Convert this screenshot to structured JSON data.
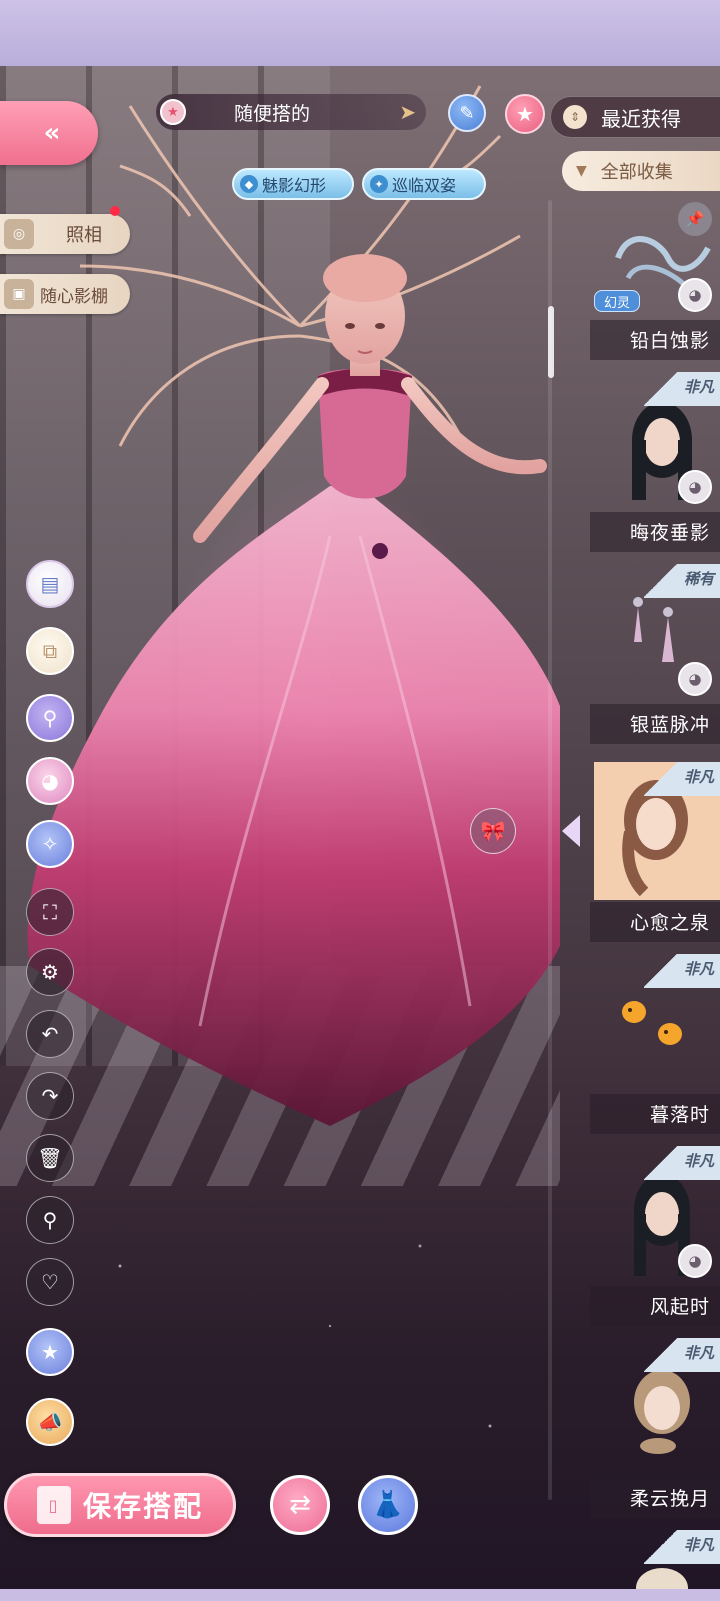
{
  "outfit": {
    "name": "随便搭的"
  },
  "skills": [
    {
      "label": "魅影幻形"
    },
    {
      "label": "巡临双姿"
    }
  ],
  "side_buttons": {
    "photo": "照相",
    "studio": "随心影棚"
  },
  "wardrobe": {
    "sort_label": "最近获得",
    "filter_label": "全部收集",
    "items": [
      {
        "name": "铅白蚀影",
        "tag": "幻灵"
      },
      {
        "name": "晦夜垂影",
        "rarity": "非凡"
      },
      {
        "name": "银蓝脉冲",
        "rarity": "稀有"
      },
      {
        "name": "心愈之泉",
        "rarity": "非凡"
      },
      {
        "name": "暮落时",
        "rarity": "非凡"
      },
      {
        "name": "风起时",
        "rarity": "非凡"
      },
      {
        "name": "柔云挽月",
        "rarity": "非凡"
      },
      {
        "rarity": "非凡"
      }
    ]
  },
  "bottom": {
    "save_label": "保存搭配"
  },
  "colors": {
    "accent_pink": "#ef6c8c",
    "panel_cream": "#f1e5d6",
    "skill_blue": "#7bbfe8"
  },
  "icons": {
    "tools": [
      "outfit-preset-icon",
      "layer-add-icon",
      "search-filter-icon",
      "palette-icon",
      "star-magic-icon",
      "fullscreen-icon",
      "settings-gear-icon",
      "undo-icon",
      "redo-icon",
      "trash-icon",
      "search-icon",
      "heart-icon",
      "star-badge-icon",
      "megaphone-icon"
    ]
  }
}
